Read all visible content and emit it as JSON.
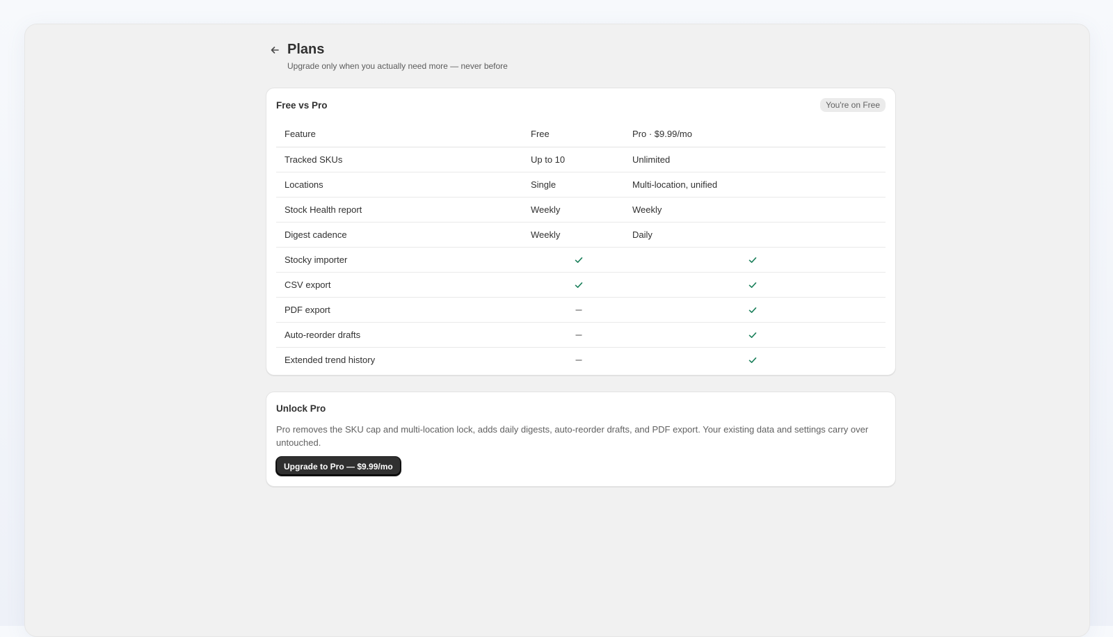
{
  "header": {
    "back_icon": "arrow-left-icon",
    "title": "Plans",
    "subtitle": "Upgrade only when you actually need more — never before"
  },
  "compare": {
    "title": "Free vs Pro",
    "badge": "You're on Free",
    "columns": {
      "feature": "Feature",
      "free": "Free",
      "pro": "Pro · $9.99/mo"
    },
    "rows": [
      {
        "feature": "Tracked SKUs",
        "free": "Up to 10",
        "pro": "Unlimited"
      },
      {
        "feature": "Locations",
        "free": "Single",
        "pro": "Multi-location, unified"
      },
      {
        "feature": "Stock Health report",
        "free": "Weekly",
        "pro": "Weekly"
      },
      {
        "feature": "Digest cadence",
        "free": "Weekly",
        "pro": "Daily"
      },
      {
        "feature": "Stocky importer",
        "free_included": true,
        "pro_included": true
      },
      {
        "feature": "CSV export",
        "free_included": true,
        "pro_included": true
      },
      {
        "feature": "PDF export",
        "free_included": false,
        "pro_included": true
      },
      {
        "feature": "Auto-reorder drafts",
        "free_included": false,
        "pro_included": true
      },
      {
        "feature": "Extended trend history",
        "free_included": false,
        "pro_included": true
      }
    ],
    "check_color": "#1a7f5a",
    "dash_color": "#8a8a8a"
  },
  "unlock": {
    "title": "Unlock Pro",
    "body": "Pro removes the SKU cap and multi-location lock, adds daily digests, auto-reorder drafts, and PDF export. Your existing data and settings carry over untouched.",
    "button_label": "Upgrade to Pro — $9.99/mo"
  }
}
